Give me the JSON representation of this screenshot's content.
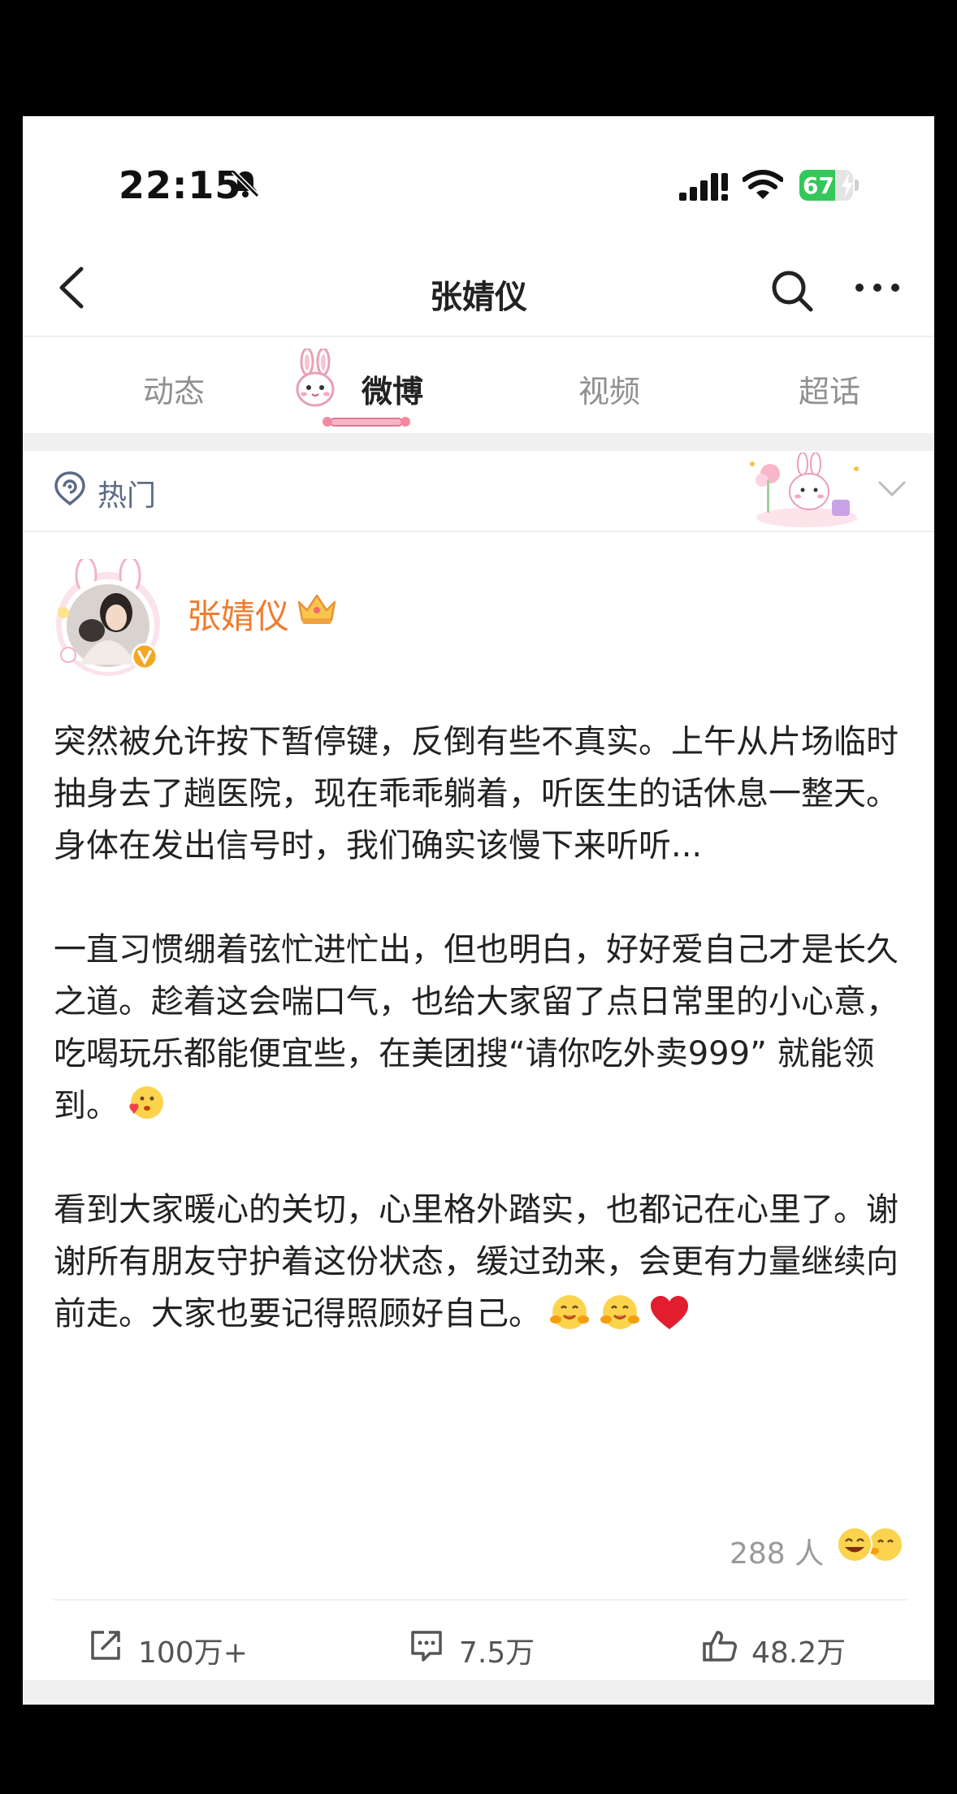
{
  "status_bar": {
    "time": "22:15",
    "battery_text": "67",
    "battery_level": 0.67,
    "battery_color": "#34c759"
  },
  "nav": {
    "title": "张婧仪",
    "back_icon": "chevron-left-icon",
    "search_icon": "search-icon",
    "more_icon": "more-dots-icon"
  },
  "tabs": [
    {
      "label": "动态",
      "active": false
    },
    {
      "label": "微博",
      "active": true
    },
    {
      "label": "视频",
      "active": false
    },
    {
      "label": "超话",
      "active": false
    }
  ],
  "filter": {
    "label": "热门",
    "icon": "hot-filter-icon"
  },
  "post": {
    "username": "张婧仪",
    "username_color": "#f07c2f",
    "paragraphs": [
      "突然被允许按下暂停键，反倒有些不真实。上午从片场临时抽身去了趟医院，现在乖乖躺着，听医生的话休息一整天。身体在发出信号时，我们确实该慢下来听听...",
      "一直习惯绷着弦忙进忙出，但也明白，好好爱自己才是长久之道。趁着这会喘口气，也给大家留了点日常里的小心意，吃喝玩乐都能便宜些，在美团搜“请你吃外卖999” 就能领到。",
      "看到大家暖心的关切，心里格外踏实，也都记在心里了。谢谢所有朋友守护着这份状态，缓过劲来，会更有力量继续向前走。大家也要记得照顾好自己。"
    ],
    "likers_text": "288 人",
    "actions": {
      "repost": "100万+",
      "comment": "7.5万",
      "like": "48.2万"
    }
  }
}
